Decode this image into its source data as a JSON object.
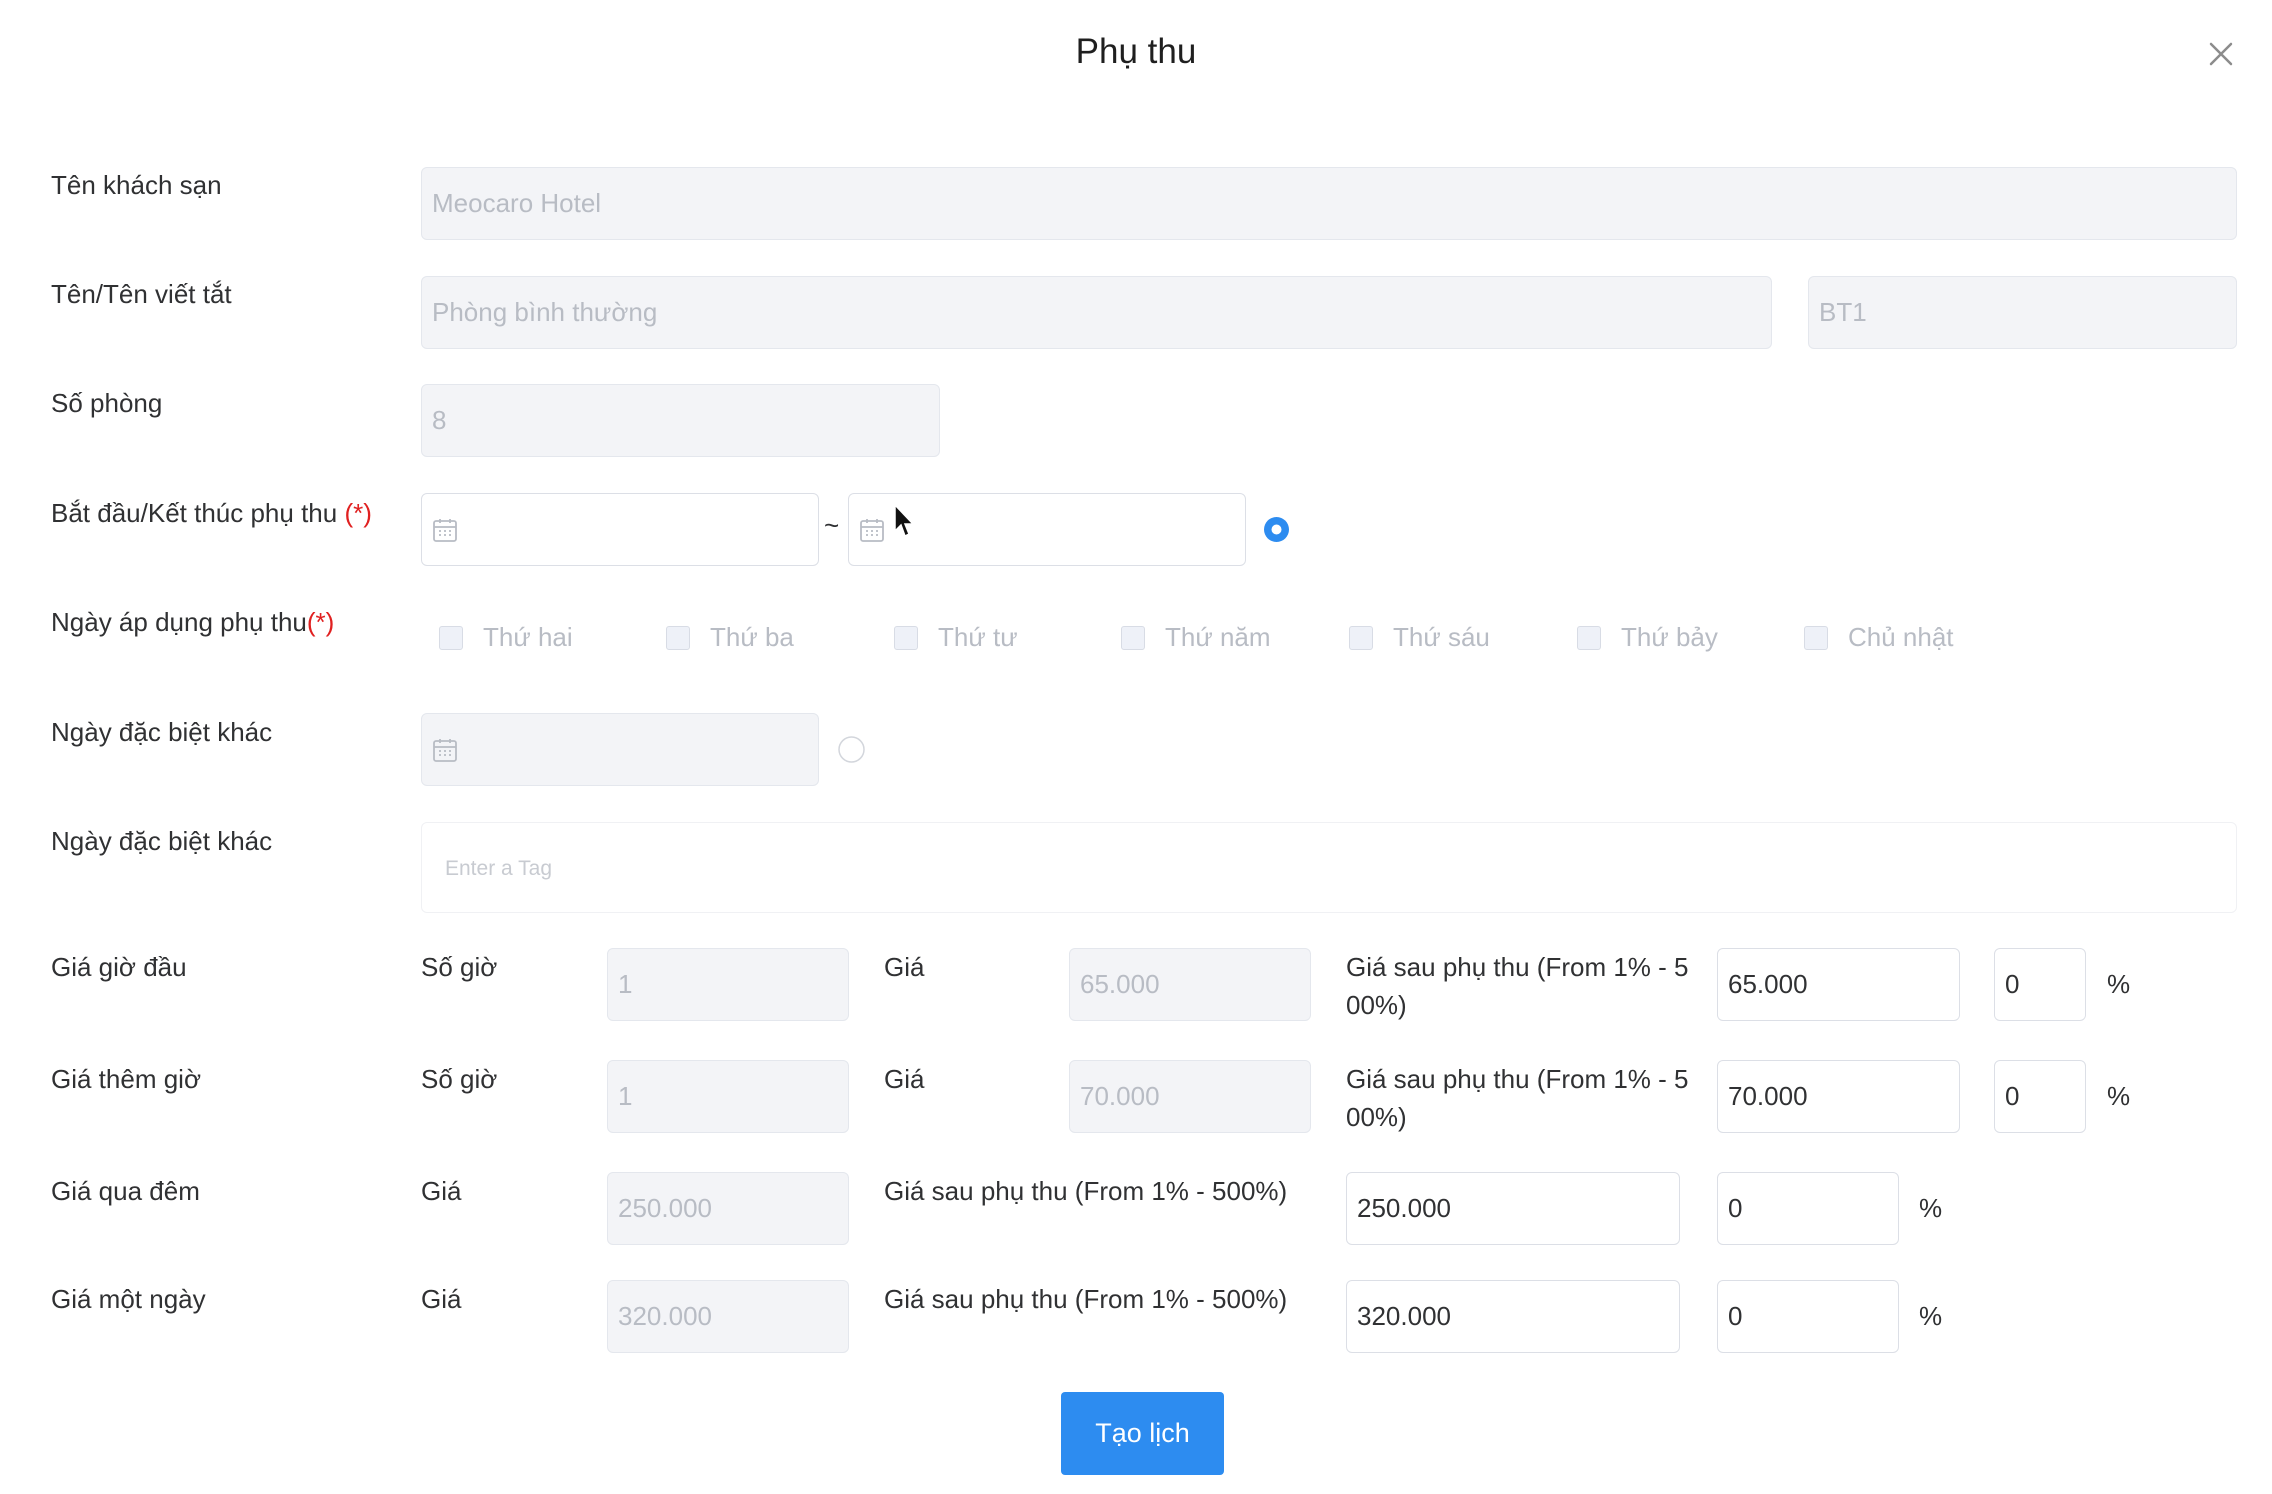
{
  "dialog": {
    "title": "Phụ thu",
    "close_icon": "close-icon"
  },
  "hotel_name": {
    "label": "Tên khách sạn",
    "value": "Meocaro Hotel"
  },
  "room_name": {
    "label": "Tên/Tên viết tắt",
    "name_value": "Phòng bình thường",
    "short_value": "BT1"
  },
  "room_count": {
    "label": "Số phòng",
    "value": "8"
  },
  "surcharge_period": {
    "label": "Bắt đầu/Kết thúc phụ thu",
    "required_mark": "(*)",
    "separator": "~",
    "start_value": "",
    "end_value": "",
    "radio_selected": true
  },
  "apply_days": {
    "label": "Ngày áp dụng phụ thu",
    "required_mark": "(*)",
    "days": [
      "Thứ hai",
      "Thứ ba",
      "Thứ tư",
      "Thứ năm",
      "Thứ sáu",
      "Thứ bảy",
      "Chủ nhật"
    ]
  },
  "special_date": {
    "label": "Ngày đặc biệt khác",
    "value": "",
    "radio_selected": false
  },
  "special_tags": {
    "label": "Ngày đặc biệt khác",
    "placeholder": "Enter a Tag"
  },
  "first_hour": {
    "label": "Giá giờ đầu",
    "hours_label": "Số giờ",
    "hours_value": "1",
    "price_label": "Giá",
    "price_value": "65.000",
    "after_label": "Giá sau phụ thu (From 1% - 5 00%)",
    "after_value": "65.000",
    "percent_value": "0",
    "percent_sign": "%"
  },
  "extra_hour": {
    "label": "Giá thêm giờ",
    "hours_label": "Số giờ",
    "hours_value": "1",
    "price_label": "Giá",
    "price_value": "70.000",
    "after_label": "Giá sau phụ thu (From 1% - 5 00%)",
    "after_value": "70.000",
    "percent_value": "0",
    "percent_sign": "%"
  },
  "overnight": {
    "label": "Giá qua đêm",
    "price_label": "Giá",
    "price_value": "250.000",
    "after_label": "Giá sau phụ thu (From 1% - 500%)",
    "after_value": "250.000",
    "percent_value": "0",
    "percent_sign": "%"
  },
  "full_day": {
    "label": "Giá một ngày",
    "price_label": "Giá",
    "price_value": "320.000",
    "after_label": "Giá sau phụ thu (From 1% - 500%)",
    "after_value": "320.000",
    "percent_value": "0",
    "percent_sign": "%"
  },
  "submit_button": "Tạo lịch",
  "colors": {
    "primary": "#2d8cf0",
    "required": "#e02020",
    "disabled_bg": "#f3f4f7"
  }
}
